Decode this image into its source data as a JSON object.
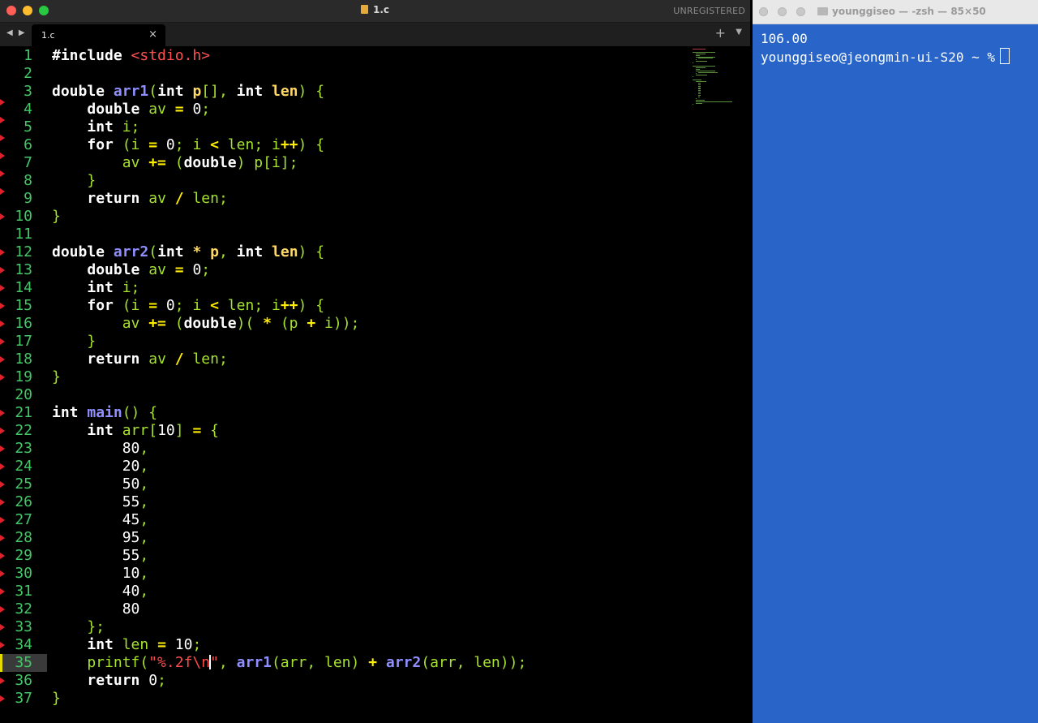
{
  "editor": {
    "window_title": "1.c",
    "status_text": "UNREGISTERED",
    "tab": {
      "label": "1.c",
      "close_symbol": "×"
    },
    "new_tab_symbol": "+",
    "tab_menu_symbol": "▼",
    "tab_nav_symbols": "◀ ▶",
    "current_line": 35,
    "lines": [
      "#include <stdio.h>",
      "",
      "double arr1(int p[], int len) {",
      "    double av = 0;",
      "    int i;",
      "    for (i = 0; i < len; i++) {",
      "        av += (double) p[i];",
      "    }",
      "    return av / len;",
      "}",
      "",
      "double arr2(int * p, int len) {",
      "    double av = 0;",
      "    int i;",
      "    for (i = 0; i < len; i++) {",
      "        av += (double)( * (p + i));",
      "    }",
      "    return av / len;",
      "}",
      "",
      "int main() {",
      "    int arr[10] = {",
      "        80,",
      "        20,",
      "        50,",
      "        55,",
      "        45,",
      "        95,",
      "        55,",
      "        10,",
      "        40,",
      "        80",
      "    };",
      "    int len = 10;",
      "    printf(\"%.2f\\n\", arr1(arr, len) + arr2(arr, len));",
      "    return 0;",
      "}"
    ]
  },
  "terminal": {
    "title": "younggiseo — -zsh — 85×50",
    "output_line": "106.00",
    "prompt": "younggiseo@jeongmin-ui-S20 ~ %"
  },
  "colors": {
    "editor_bg": "#000000",
    "line_number": "#44c766",
    "default_code": "#a6e22e",
    "keyword": "#ffffff",
    "function_name": "#8f8fff",
    "parameter": "#ffd866",
    "operator": "#ffee00",
    "string": "#ff4a4a",
    "terminal_bg": "#2965c9"
  }
}
